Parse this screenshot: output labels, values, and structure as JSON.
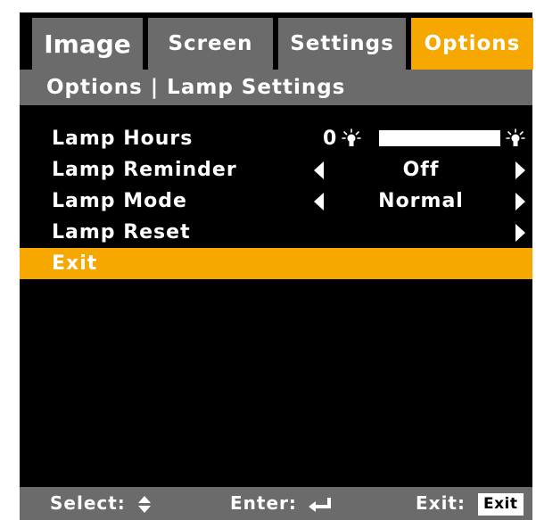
{
  "tabs": [
    {
      "label": "Image",
      "active": false
    },
    {
      "label": "Screen",
      "active": false
    },
    {
      "label": "Settings",
      "active": false
    },
    {
      "label": "Options",
      "active": true
    }
  ],
  "breadcrumb": "Options | Lamp Settings",
  "rows": {
    "lamp_hours": {
      "label": "Lamp Hours",
      "value": "0",
      "icon": "lamp-icon"
    },
    "lamp_reminder": {
      "label": "Lamp Reminder",
      "value": "Off"
    },
    "lamp_mode": {
      "label": "Lamp Mode",
      "value": "Normal"
    },
    "lamp_reset": {
      "label": "Lamp Reset"
    },
    "exit": {
      "label": "Exit",
      "selected": true
    }
  },
  "footer": {
    "select_label": "Select:",
    "enter_label": "Enter:",
    "exit_label": "Exit:",
    "exit_key": "Exit"
  },
  "colors": {
    "accent": "#f7a800",
    "panel": "#6b6b6b",
    "background": "#000000",
    "text": "#ffffff"
  }
}
